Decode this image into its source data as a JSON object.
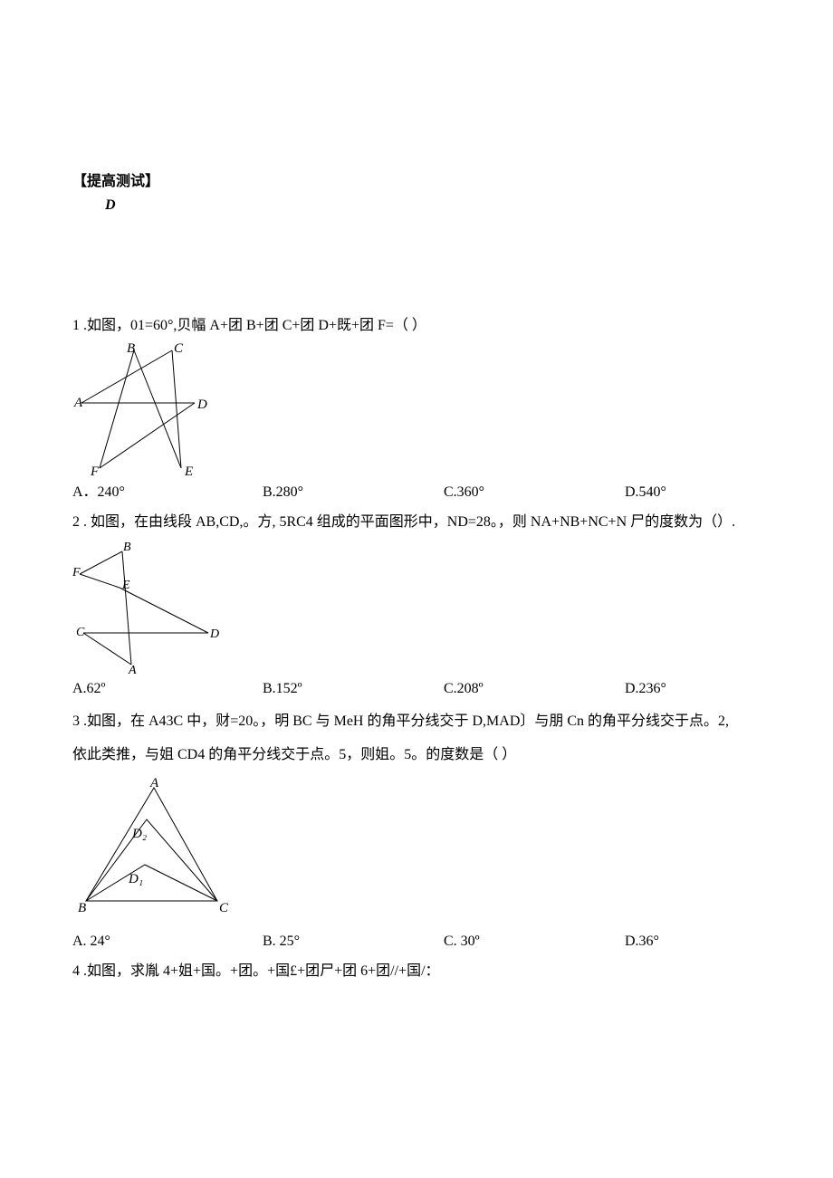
{
  "section_header": "【提高测试】",
  "header_sub": "D",
  "q1": {
    "num": "1",
    "text": " .如图，01=60°,贝幅 A+团 B+团 C+团 D+既+团 F=（    ）",
    "labels": {
      "A": "A",
      "B": "B",
      "C": "C",
      "D": "D",
      "E": "E",
      "F": "F"
    },
    "opts": {
      "a": "A．240°",
      "b": "B.280°",
      "c": "C.360°",
      "d": "D.540°"
    }
  },
  "q2": {
    "num": "2",
    "text": " . 如图，在由线段 AB,CD,。方, 5RC4 组成的平面图形中，ND=28。，则 NA+NB+NC+N 尸的度数为（）.",
    "labels": {
      "A": "A",
      "B": "B",
      "C": "C",
      "D": "D",
      "E": "E",
      "F": "F"
    },
    "opts": {
      "a": "A.62º",
      "b": "B.152º",
      "c": "C.208º",
      "d": "D.236°"
    }
  },
  "q3": {
    "num": "3",
    "text_line1": " .如图，在 A43C 中，财=20。，明 BC 与 MeH 的角平分线交于 D,MAD〕与朋 Cn 的角平分线交于点。2,",
    "text_line2": "依此类推，与姐 CD4 的角平分线交于点。5，则姐。5。的度数是（              ）",
    "labels": {
      "A": "A",
      "B": "B",
      "C": "C",
      "D1": "D₁",
      "D2": "D₂"
    },
    "opts": {
      "a": "A.  24°",
      "b": "B.  25°",
      "c": "C.  30º",
      "d": "D.36°"
    }
  },
  "q4": {
    "num": "4",
    "text": " .如图，求胤 4+姐+国。+团。+国£+团尸+团 6+团//+国/："
  }
}
